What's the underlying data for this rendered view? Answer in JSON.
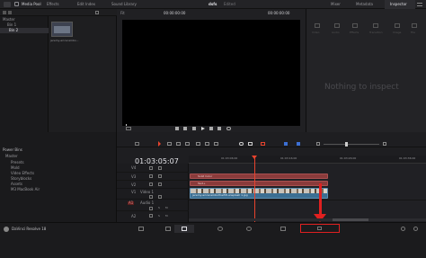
{
  "topbar": {
    "tabs": [
      {
        "label": "Media Pool",
        "icon": "media-pool-icon"
      },
      {
        "label": "Effects",
        "icon": "effects-icon"
      },
      {
        "label": "Edit Index",
        "icon": "edit-index-icon"
      },
      {
        "label": "Sound Library",
        "icon": "sound-library-icon"
      }
    ],
    "project_title": "dsfs",
    "project_status": "Edited",
    "right_tabs": [
      {
        "label": "Mixer",
        "icon": "mixer-icon"
      },
      {
        "label": "Metadata",
        "icon": "metadata-icon"
      },
      {
        "label": "Inspector",
        "icon": "inspector-icon"
      }
    ]
  },
  "media": {
    "fit_label": "Fit",
    "timecode_left": "00:00:00:00",
    "timecode_right": "00:00:00:00",
    "master_label": "Master",
    "bins": [
      "Bin 1",
      "Bin 2"
    ],
    "clip_name": "jeremy-ericscambo..."
  },
  "viewer": {
    "transport": [
      "jump-start-icon",
      "step-back-icon",
      "stop-icon",
      "play-icon",
      "step-forward-icon",
      "jump-end-icon",
      "loop-icon"
    ]
  },
  "inspector": {
    "tabs": [
      "Video",
      "Audio",
      "Effects",
      "Transition",
      "Image",
      "File"
    ],
    "empty_message": "Nothing to inspect"
  },
  "power_bins": {
    "title": "Power Bins",
    "items": [
      "Master",
      "Presets",
      "Mold",
      "Video Effects",
      "Storyblocks",
      "Assets",
      "M3 MacBook Air"
    ]
  },
  "timeline": {
    "current_timecode": "01:03:05:07",
    "ruler_labels": [
      "01:03:06:00",
      "01:03:16:00",
      "01:03:26:00",
      "01:03:36:00"
    ],
    "tracks": [
      {
        "id": "V4",
        "name": ""
      },
      {
        "id": "V3",
        "name": ""
      },
      {
        "id": "V2",
        "name": ""
      },
      {
        "id": "V1",
        "name": "Video 1"
      },
      {
        "id": "A1",
        "name": "Audio 1"
      },
      {
        "id": "A2",
        "name": ""
      }
    ],
    "clips": {
      "solid_color": "Solid Color",
      "text": "Text+",
      "video": "jeremy-ericscambo?hei5fl-unsplash 1.jpg"
    }
  },
  "bottombar": {
    "app_name": "DaVinci Resolve 18",
    "pages": [
      "media-page-icon",
      "cut-page-icon",
      "edit-page-icon",
      "fusion-page-icon",
      "color-page-icon",
      "fairlight-page-icon",
      "deliver-page-icon"
    ],
    "active_page_index": 2,
    "highlighted_page_index": 6
  },
  "colors": {
    "accent": "#e8432d",
    "annotation_red": "#e02020",
    "solid_clip": "#8a3b3b",
    "text_clip": "#8a3b3b",
    "video_clip": "#3c6f93",
    "playhead": "#e8432d"
  }
}
